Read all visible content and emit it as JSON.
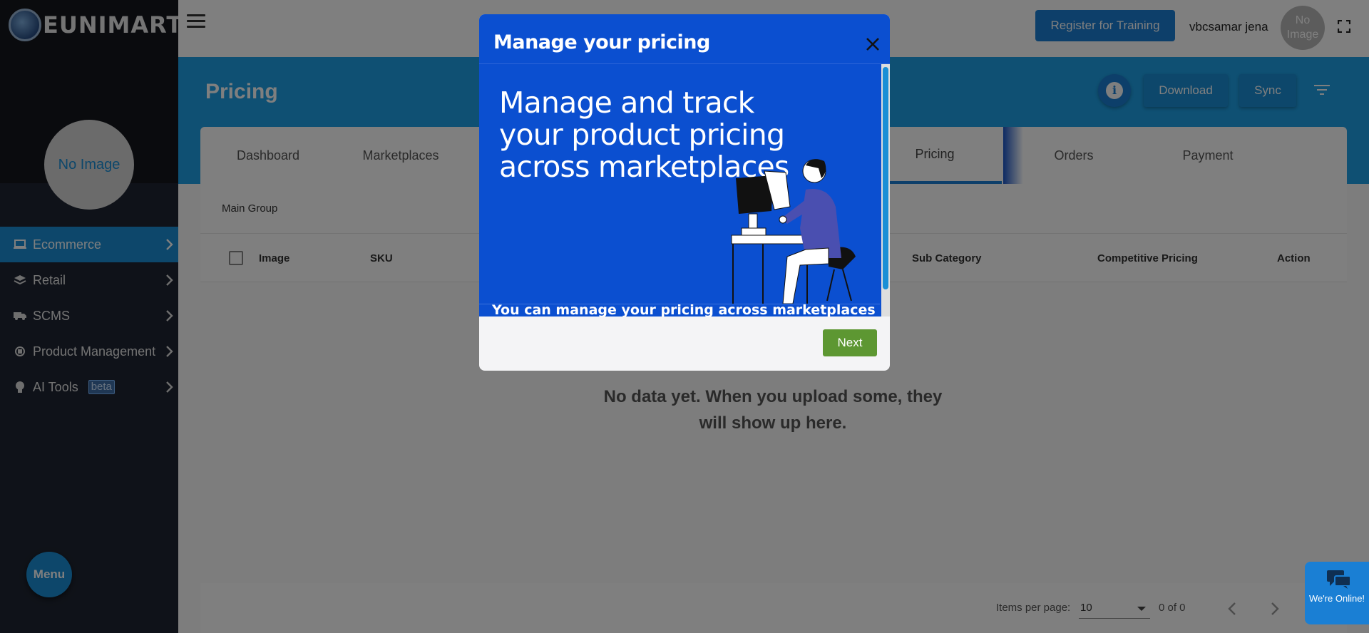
{
  "brand": {
    "logo_text": "EUNIMART"
  },
  "sidebar": {
    "profile_avatar": "No Image",
    "items": [
      {
        "label": "Ecommerce",
        "icon": "laptop-icon",
        "active": true
      },
      {
        "label": "Retail",
        "icon": "layers-icon"
      },
      {
        "label": "SCMS",
        "icon": "truck-icon"
      },
      {
        "label": "Product Management",
        "icon": "chip-icon"
      },
      {
        "label": "AI Tools",
        "icon": "brain-icon",
        "badge": "beta"
      }
    ],
    "menu_button": "Menu"
  },
  "topbar": {
    "training_button": "Register for Training",
    "username": "vbcsamar jena",
    "avatar_text": "No Image"
  },
  "header": {
    "title": "Pricing",
    "info_glyph": "i",
    "download_label": "Download",
    "sync_label": "Sync"
  },
  "tabs": [
    {
      "label": "Dashboard"
    },
    {
      "label": "Marketplaces"
    },
    {
      "label": "Pricing",
      "active": true
    },
    {
      "label": "Orders"
    },
    {
      "label": "Payment"
    }
  ],
  "table": {
    "group_label": "Main Group",
    "columns": {
      "image": "Image",
      "sku": "SKU",
      "sub_category": "Sub Category",
      "competitive_pricing": "Competitive Pricing",
      "action": "Action"
    },
    "empty_message": "No data yet. When you upload some, they will show up here."
  },
  "pagination": {
    "items_per_page_label": "Items per page:",
    "items_per_page_value": "10",
    "range": "0 of 0"
  },
  "chat": {
    "label": "We're Online!"
  },
  "modal": {
    "title": "Manage your pricing",
    "promo": "Manage and track your product pricing across marketplaces",
    "description": "You can manage your pricing across marketplaces",
    "next_label": "Next"
  },
  "colors": {
    "sidebar_bg": "#1f2532",
    "accent": "#1a8fd6",
    "header_bg": "#1ea0e6",
    "modal_blue": "#0b4fd0",
    "next_green": "#5d9732"
  }
}
